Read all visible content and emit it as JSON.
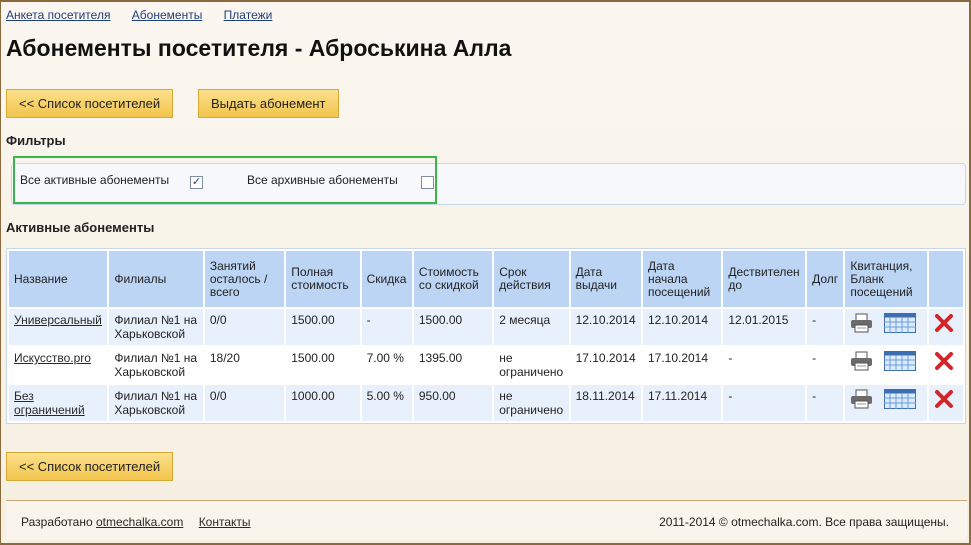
{
  "nav": {
    "items": [
      "Анкета посетителя",
      "Абонементы",
      "Платежи"
    ]
  },
  "page_title": "Абонементы посетителя - Аброськина Алла",
  "buttons": {
    "back_list": "<< Список посетителей",
    "issue": "Выдать абонемент"
  },
  "filters": {
    "title": "Фильтры",
    "active_label": "Все активные абонементы",
    "active_checked": true,
    "archived_label": "Все архивные абонементы",
    "archived_checked": false
  },
  "active_title": "Активные абонементы",
  "table": {
    "headers": [
      "Название",
      "Филиалы",
      "Занятий осталось / всего",
      "Полная стоимость",
      "Скидка",
      "Стоимость со скидкой",
      "Срок действия",
      "Дата выдачи",
      "Дата начала посещений",
      "Дествителен до",
      "Долг",
      "Квитанция, Бланк посещений",
      ""
    ],
    "rows": [
      {
        "name": "Универсальный",
        "branch": "Филиал №1 на Харьковской",
        "lessons": "0/0",
        "full": "1500.00",
        "discount": "-",
        "discounted": "1500.00",
        "term": "2 месяца",
        "issued": "12.10.2014",
        "start": "12.10.2014",
        "valid": "12.01.2015",
        "debt": "-"
      },
      {
        "name": "Искусство.pro",
        "branch": "Филиал №1 на Харьковской",
        "lessons": "18/20",
        "full": "1500.00",
        "discount": "7.00 %",
        "discounted": "1395.00",
        "term": "не ограничено",
        "issued": "17.10.2014",
        "start": "17.10.2014",
        "valid": "-",
        "debt": "-"
      },
      {
        "name": "Без ограничений",
        "branch": "Филиал №1 на Харьковской",
        "lessons": "0/0",
        "full": "1000.00",
        "discount": "5.00 %",
        "discounted": "950.00",
        "term": "не ограничено",
        "issued": "18.11.2014",
        "start": "17.11.2014",
        "valid": "-",
        "debt": "-"
      }
    ]
  },
  "icons": {
    "receipt": "printer-icon",
    "attendance": "calendar-grid-icon",
    "delete": "delete-x-icon"
  },
  "colors": {
    "button": "#f2c54d",
    "header": "#bcd5f4",
    "delete": "#d3242a",
    "highlight": "#3bb54a"
  },
  "footer": {
    "developed_prefix": "Разработано",
    "developed_link": "otmechalka.com",
    "contacts": "Контакты",
    "copyright": "2011-2014 © otmechalka.com. Все права защищены."
  }
}
